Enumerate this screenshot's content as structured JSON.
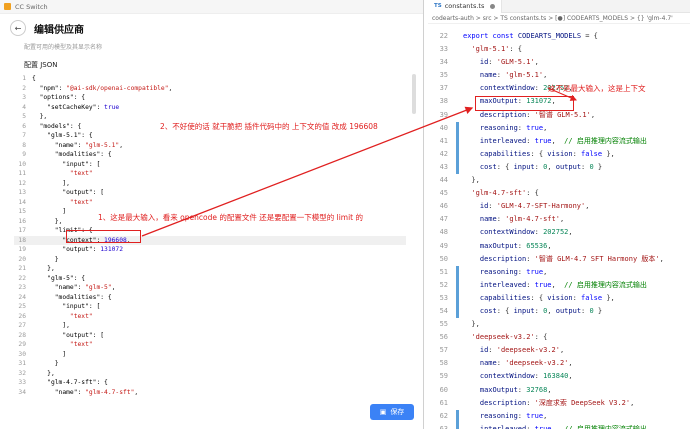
{
  "left_window": {
    "app_title": "CC Switch",
    "page_title": "编辑供应商",
    "subtitle": "配置可用的模型及其显示名称",
    "config_label": "配置 JSON",
    "save_label": "保存",
    "code_lines": [
      {
        "n": "1",
        "t": "{"
      },
      {
        "n": "2",
        "t": "  \"npm\": \"@ai-sdk/openai-compatible\","
      },
      {
        "n": "3",
        "t": "  \"options\": {"
      },
      {
        "n": "4",
        "t": "    \"setCacheKey\": true"
      },
      {
        "n": "5",
        "t": "  },"
      },
      {
        "n": "6",
        "t": "  \"models\": {"
      },
      {
        "n": "7",
        "t": "    \"glm-5.1\": {"
      },
      {
        "n": "8",
        "t": "      \"name\": \"glm-5.1\","
      },
      {
        "n": "9",
        "t": "      \"modalities\": {"
      },
      {
        "n": "10",
        "t": "        \"input\": ["
      },
      {
        "n": "11",
        "t": "          \"text\""
      },
      {
        "n": "12",
        "t": "        ],"
      },
      {
        "n": "13",
        "t": "        \"output\": ["
      },
      {
        "n": "14",
        "t": "          \"text\""
      },
      {
        "n": "15",
        "t": "        ]"
      },
      {
        "n": "16",
        "t": "      },"
      },
      {
        "n": "17",
        "t": "      \"limit\": {"
      },
      {
        "n": "18",
        "t": "        \"context\": 196608,"
      },
      {
        "n": "19",
        "t": "        \"output\": 131072"
      },
      {
        "n": "20",
        "t": "      }"
      },
      {
        "n": "21",
        "t": "    },"
      },
      {
        "n": "22",
        "t": "    \"glm-5\": {"
      },
      {
        "n": "23",
        "t": "      \"name\": \"glm-5\","
      },
      {
        "n": "24",
        "t": "      \"modalities\": {"
      },
      {
        "n": "25",
        "t": "        \"input\": ["
      },
      {
        "n": "26",
        "t": "          \"text\""
      },
      {
        "n": "27",
        "t": "        ],"
      },
      {
        "n": "28",
        "t": "        \"output\": ["
      },
      {
        "n": "29",
        "t": "          \"text\""
      },
      {
        "n": "30",
        "t": "        ]"
      },
      {
        "n": "31",
        "t": "      }"
      },
      {
        "n": "32",
        "t": "    },"
      },
      {
        "n": "33",
        "t": "    \"glm-4.7-sft\": {"
      },
      {
        "n": "34",
        "t": "      \"name\": \"glm-4.7-sft\","
      },
      {
        "n": "35",
        "t": "      \"modalities\": {"
      }
    ]
  },
  "right_window": {
    "tab_label": "constants.ts",
    "breadcrumb": "codearts-auth > src > TS constants.ts > [●] CODEARTS_MODELS > {} 'glm-4.7'",
    "code_lines": [
      {
        "n": "22",
        "segs": [
          [
            "kw",
            "export "
          ],
          [
            "kw",
            "const "
          ],
          [
            "ident",
            "CODEARTS_MODELS"
          ],
          [
            "pun",
            " = {"
          ]
        ]
      },
      {
        "n": "33",
        "segs": [
          [
            "plain",
            "  "
          ],
          [
            "str",
            "'glm-5.1'"
          ],
          [
            "pun",
            ": {"
          ]
        ]
      },
      {
        "n": "34",
        "segs": [
          [
            "plain",
            "    "
          ],
          [
            "ident",
            "id"
          ],
          [
            "pun",
            ": "
          ],
          [
            "str",
            "'GLM-5.1'"
          ],
          [
            "pun",
            ","
          ]
        ]
      },
      {
        "n": "35",
        "segs": [
          [
            "plain",
            "    "
          ],
          [
            "ident",
            "name"
          ],
          [
            "pun",
            ": "
          ],
          [
            "str",
            "'glm-5.1'"
          ],
          [
            "pun",
            ","
          ]
        ]
      },
      {
        "n": "37",
        "segs": [
          [
            "plain",
            "    "
          ],
          [
            "ident",
            "contextWindow"
          ],
          [
            "pun",
            ": "
          ],
          [
            "num",
            "202752"
          ],
          [
            "pun",
            ","
          ]
        ]
      },
      {
        "n": "38",
        "segs": [
          [
            "plain",
            "    "
          ],
          [
            "ident",
            "maxOutput"
          ],
          [
            "pun",
            ": "
          ],
          [
            "num",
            "131072"
          ],
          [
            "pun",
            ","
          ]
        ]
      },
      {
        "n": "39",
        "segs": [
          [
            "plain",
            "    "
          ],
          [
            "ident",
            "description"
          ],
          [
            "pun",
            ": "
          ],
          [
            "str",
            "'智谱 GLM-5.1'"
          ],
          [
            "pun",
            ","
          ]
        ]
      },
      {
        "n": "40",
        "segs": [
          [
            "plain",
            "    "
          ],
          [
            "ident",
            "reasoning"
          ],
          [
            "pun",
            ": "
          ],
          [
            "kw",
            "true"
          ],
          [
            "pun",
            ","
          ]
        ]
      },
      {
        "n": "41",
        "segs": [
          [
            "plain",
            "    "
          ],
          [
            "ident",
            "interleaved"
          ],
          [
            "pun",
            ": "
          ],
          [
            "kw",
            "true"
          ],
          [
            "pun",
            ",  "
          ],
          [
            "cmt",
            "// 启用推理内容流式输出"
          ]
        ]
      },
      {
        "n": "42",
        "segs": [
          [
            "plain",
            "    "
          ],
          [
            "ident",
            "capabilities"
          ],
          [
            "pun",
            ": { "
          ],
          [
            "ident",
            "vision"
          ],
          [
            "pun",
            ": "
          ],
          [
            "kw",
            "false"
          ],
          [
            "pun",
            " },"
          ]
        ]
      },
      {
        "n": "43",
        "segs": [
          [
            "plain",
            "    "
          ],
          [
            "ident",
            "cost"
          ],
          [
            "pun",
            ": { "
          ],
          [
            "ident",
            "input"
          ],
          [
            "pun",
            ": "
          ],
          [
            "num",
            "0"
          ],
          [
            "pun",
            ", "
          ],
          [
            "ident",
            "output"
          ],
          [
            "pun",
            ": "
          ],
          [
            "num",
            "0"
          ],
          [
            "pun",
            " }"
          ]
        ]
      },
      {
        "n": "44",
        "segs": [
          [
            "pun",
            "  },"
          ]
        ]
      },
      {
        "n": "45",
        "segs": [
          [
            "plain",
            "  "
          ],
          [
            "str",
            "'glm-4.7-sft'"
          ],
          [
            "pun",
            ": {"
          ]
        ]
      },
      {
        "n": "46",
        "segs": [
          [
            "plain",
            "    "
          ],
          [
            "ident",
            "id"
          ],
          [
            "pun",
            ": "
          ],
          [
            "str",
            "'GLM-4.7-SFT-Harmony'"
          ],
          [
            "pun",
            ","
          ]
        ]
      },
      {
        "n": "47",
        "segs": [
          [
            "plain",
            "    "
          ],
          [
            "ident",
            "name"
          ],
          [
            "pun",
            ": "
          ],
          [
            "str",
            "'glm-4.7-sft'"
          ],
          [
            "pun",
            ","
          ]
        ]
      },
      {
        "n": "48",
        "segs": [
          [
            "plain",
            "    "
          ],
          [
            "ident",
            "contextWindow"
          ],
          [
            "pun",
            ": "
          ],
          [
            "num",
            "202752"
          ],
          [
            "pun",
            ","
          ]
        ]
      },
      {
        "n": "49",
        "segs": [
          [
            "plain",
            "    "
          ],
          [
            "ident",
            "maxOutput"
          ],
          [
            "pun",
            ": "
          ],
          [
            "num",
            "65536"
          ],
          [
            "pun",
            ","
          ]
        ]
      },
      {
        "n": "50",
        "segs": [
          [
            "plain",
            "    "
          ],
          [
            "ident",
            "description"
          ],
          [
            "pun",
            ": "
          ],
          [
            "str",
            "'智谱 GLM-4.7 SFT Harmony 版本'"
          ],
          [
            "pun",
            ","
          ]
        ]
      },
      {
        "n": "51",
        "segs": [
          [
            "plain",
            "    "
          ],
          [
            "ident",
            "reasoning"
          ],
          [
            "pun",
            ": "
          ],
          [
            "kw",
            "true"
          ],
          [
            "pun",
            ","
          ]
        ]
      },
      {
        "n": "52",
        "segs": [
          [
            "plain",
            "    "
          ],
          [
            "ident",
            "interleaved"
          ],
          [
            "pun",
            ": "
          ],
          [
            "kw",
            "true"
          ],
          [
            "pun",
            ",  "
          ],
          [
            "cmt",
            "// 启用推理内容流式输出"
          ]
        ]
      },
      {
        "n": "53",
        "segs": [
          [
            "plain",
            "    "
          ],
          [
            "ident",
            "capabilities"
          ],
          [
            "pun",
            ": { "
          ],
          [
            "ident",
            "vision"
          ],
          [
            "pun",
            ": "
          ],
          [
            "kw",
            "false"
          ],
          [
            "pun",
            " },"
          ]
        ]
      },
      {
        "n": "54",
        "segs": [
          [
            "plain",
            "    "
          ],
          [
            "ident",
            "cost"
          ],
          [
            "pun",
            ": { "
          ],
          [
            "ident",
            "input"
          ],
          [
            "pun",
            ": "
          ],
          [
            "num",
            "0"
          ],
          [
            "pun",
            ", "
          ],
          [
            "ident",
            "output"
          ],
          [
            "pun",
            ": "
          ],
          [
            "num",
            "0"
          ],
          [
            "pun",
            " }"
          ]
        ]
      },
      {
        "n": "55",
        "segs": [
          [
            "pun",
            "  },"
          ]
        ]
      },
      {
        "n": "56",
        "segs": [
          [
            "plain",
            "  "
          ],
          [
            "str",
            "'deepseek-v3.2'"
          ],
          [
            "pun",
            ": {"
          ]
        ]
      },
      {
        "n": "57",
        "segs": [
          [
            "plain",
            "    "
          ],
          [
            "ident",
            "id"
          ],
          [
            "pun",
            ": "
          ],
          [
            "str",
            "'deepseek-v3.2'"
          ],
          [
            "pun",
            ","
          ]
        ]
      },
      {
        "n": "58",
        "segs": [
          [
            "plain",
            "    "
          ],
          [
            "ident",
            "name"
          ],
          [
            "pun",
            ": "
          ],
          [
            "str",
            "'deepseek-v3.2'"
          ],
          [
            "pun",
            ","
          ]
        ]
      },
      {
        "n": "59",
        "segs": [
          [
            "plain",
            "    "
          ],
          [
            "ident",
            "contextWindow"
          ],
          [
            "pun",
            ": "
          ],
          [
            "num",
            "163840"
          ],
          [
            "pun",
            ","
          ]
        ]
      },
      {
        "n": "60",
        "segs": [
          [
            "plain",
            "    "
          ],
          [
            "ident",
            "maxOutput"
          ],
          [
            "pun",
            ": "
          ],
          [
            "num",
            "32768"
          ],
          [
            "pun",
            ","
          ]
        ]
      },
      {
        "n": "61",
        "segs": [
          [
            "plain",
            "    "
          ],
          [
            "ident",
            "description"
          ],
          [
            "pun",
            ": "
          ],
          [
            "str",
            "'深度求索 DeepSeek V3.2'"
          ],
          [
            "pun",
            ","
          ]
        ]
      },
      {
        "n": "62",
        "segs": [
          [
            "plain",
            "    "
          ],
          [
            "ident",
            "reasoning"
          ],
          [
            "pun",
            ": "
          ],
          [
            "kw",
            "true"
          ],
          [
            "pun",
            ","
          ]
        ]
      },
      {
        "n": "63",
        "segs": [
          [
            "plain",
            "    "
          ],
          [
            "ident",
            "interleaved"
          ],
          [
            "pun",
            ": "
          ],
          [
            "kw",
            "true"
          ],
          [
            "pun",
            ",  "
          ],
          [
            "cmt",
            "// 启用推理内容流式输出"
          ]
        ]
      }
    ]
  },
  "annotations": {
    "note_1": "1、这是最大输入，看来 opencode 的配置文件 还是要配置一下模型的 limit 的",
    "note_2": "2、不好使的话 就干脆把 插件代码中的 上下文的值 改成 196608",
    "note_3": "这不是最大输入，这是上下文"
  }
}
